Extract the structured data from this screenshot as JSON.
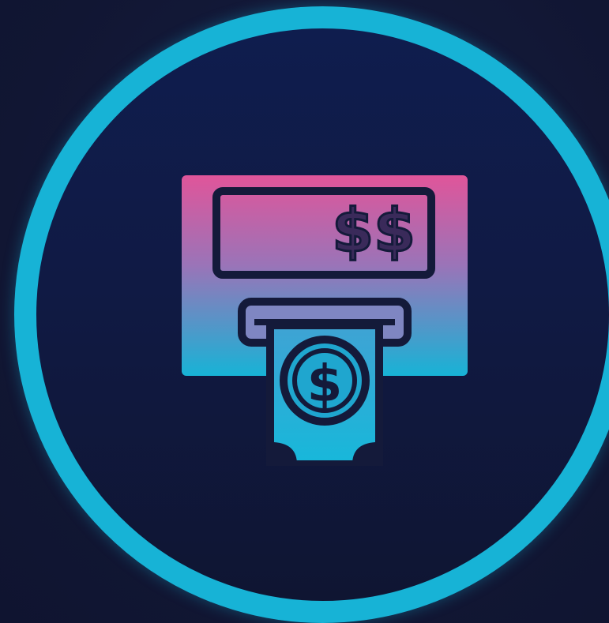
{
  "icon": {
    "name": "atm-cash-withdrawal-icon",
    "screen_text": "$$",
    "banknote_symbol": "$"
  },
  "colors": {
    "background": "#121833",
    "ring": "#17b3d6",
    "circle_fill": "#0f1d4e",
    "gradient_top": "#e0559a",
    "gradient_mid": "#9a74b8",
    "gradient_bottom": "#17b3d6",
    "outline": "#141a3a"
  }
}
